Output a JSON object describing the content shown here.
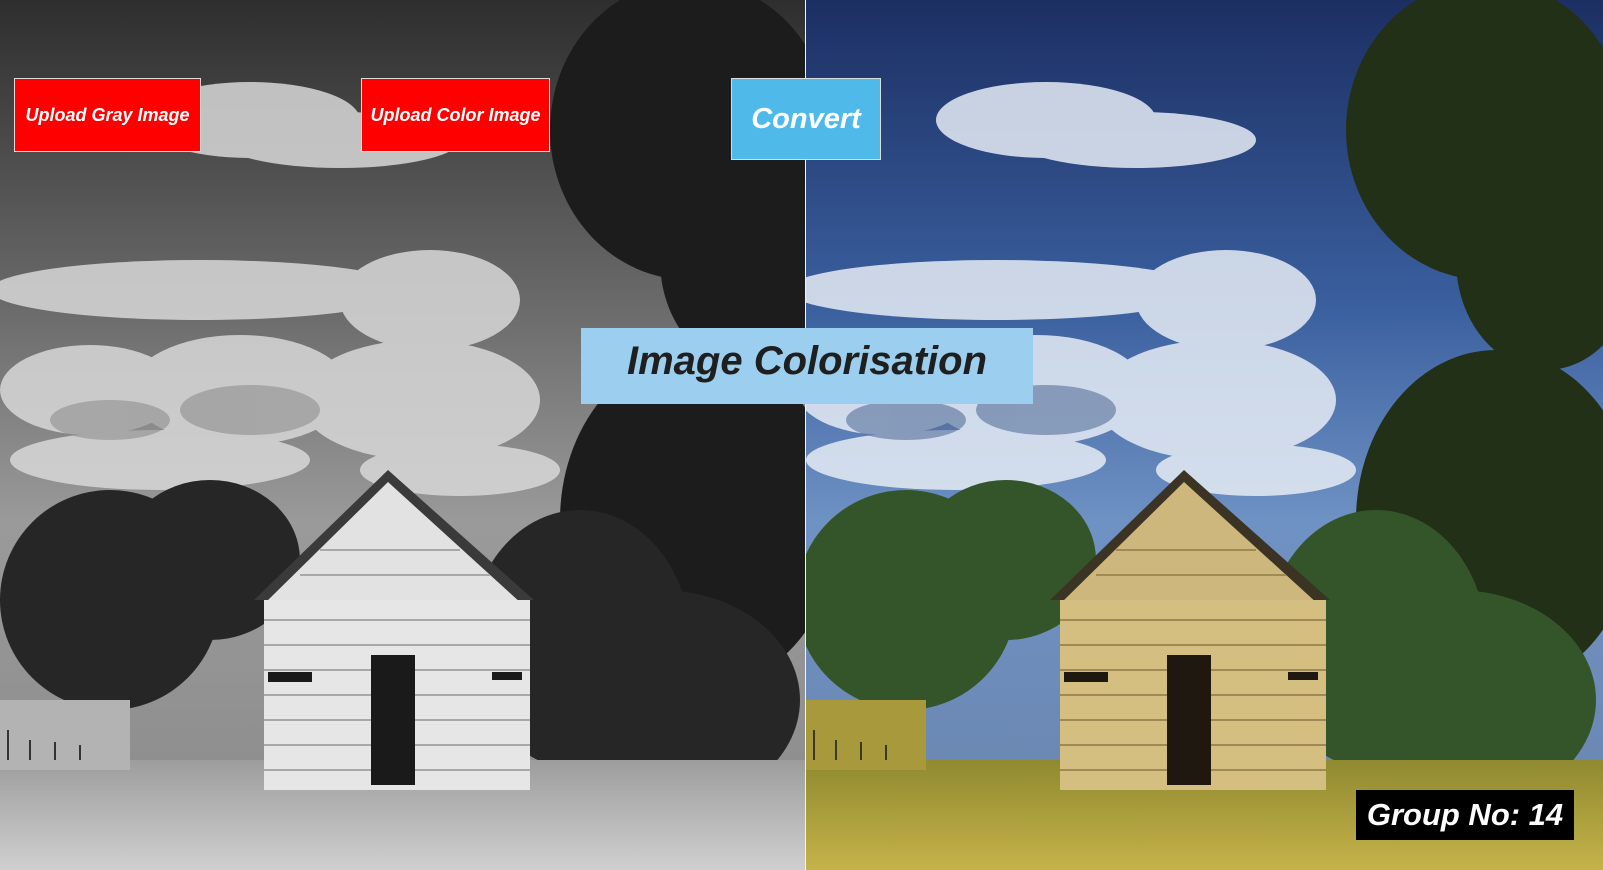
{
  "app": {
    "title": "Image Colorisation",
    "group_label": "Group No: 14"
  },
  "toolbar": {
    "upload_gray_label": "Upload Gray Image",
    "upload_color_label": "Upload Color Image",
    "convert_label": "Convert"
  },
  "images": {
    "gray": {
      "description": "grayscale photo of white wooden barn under cloudy sky with trees",
      "mode": "grayscale"
    },
    "color": {
      "description": "colorised photo of the same barn scene",
      "mode": "color"
    }
  },
  "colors": {
    "upload_button": "#ff0000",
    "convert_button": "#4fb9ea",
    "title_box": "#9ccfef",
    "group_box": "#000000",
    "color_sky": "#2a4f8f",
    "color_grass": "#b8a23a",
    "color_trees": "#3b5a2a",
    "color_barn": "#cdb77c"
  }
}
